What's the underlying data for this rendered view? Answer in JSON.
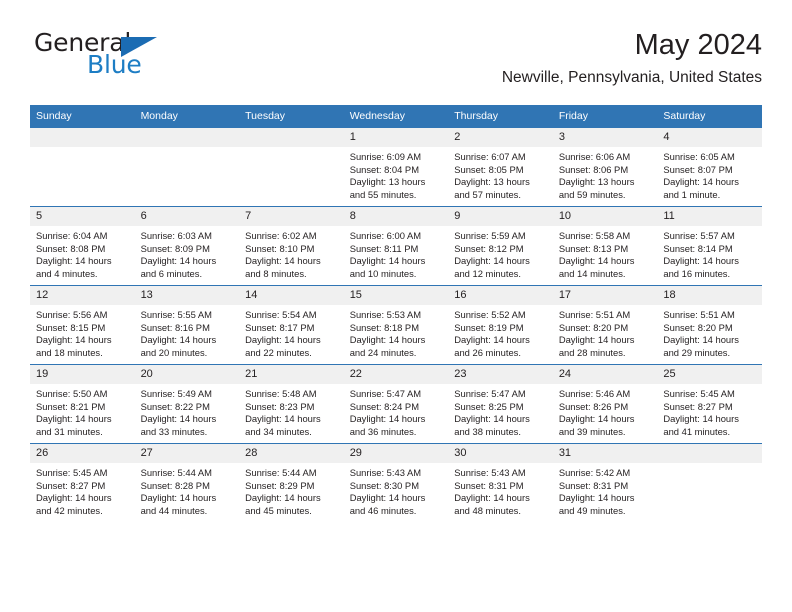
{
  "brand": {
    "name_part1": "General",
    "name_part2": "Blue",
    "triangle_color": "#1b6cb3",
    "blue_color": "#1d7dc4"
  },
  "header": {
    "title": "May 2024",
    "subtitle": "Newville, Pennsylvania, United States"
  },
  "colors": {
    "header_row_bg": "#3075b4",
    "daynum_bg": "#f0f0f0",
    "text": "#231f20"
  },
  "weekday_headers": [
    "Sunday",
    "Monday",
    "Tuesday",
    "Wednesday",
    "Thursday",
    "Friday",
    "Saturday"
  ],
  "weeks": [
    [
      {
        "day": "",
        "lines": []
      },
      {
        "day": "",
        "lines": []
      },
      {
        "day": "",
        "lines": []
      },
      {
        "day": "1",
        "lines": [
          "Sunrise: 6:09 AM",
          "Sunset: 8:04 PM",
          "Daylight: 13 hours",
          "and 55 minutes."
        ]
      },
      {
        "day": "2",
        "lines": [
          "Sunrise: 6:07 AM",
          "Sunset: 8:05 PM",
          "Daylight: 13 hours",
          "and 57 minutes."
        ]
      },
      {
        "day": "3",
        "lines": [
          "Sunrise: 6:06 AM",
          "Sunset: 8:06 PM",
          "Daylight: 13 hours",
          "and 59 minutes."
        ]
      },
      {
        "day": "4",
        "lines": [
          "Sunrise: 6:05 AM",
          "Sunset: 8:07 PM",
          "Daylight: 14 hours",
          "and 1 minute."
        ]
      }
    ],
    [
      {
        "day": "5",
        "lines": [
          "Sunrise: 6:04 AM",
          "Sunset: 8:08 PM",
          "Daylight: 14 hours",
          "and 4 minutes."
        ]
      },
      {
        "day": "6",
        "lines": [
          "Sunrise: 6:03 AM",
          "Sunset: 8:09 PM",
          "Daylight: 14 hours",
          "and 6 minutes."
        ]
      },
      {
        "day": "7",
        "lines": [
          "Sunrise: 6:02 AM",
          "Sunset: 8:10 PM",
          "Daylight: 14 hours",
          "and 8 minutes."
        ]
      },
      {
        "day": "8",
        "lines": [
          "Sunrise: 6:00 AM",
          "Sunset: 8:11 PM",
          "Daylight: 14 hours",
          "and 10 minutes."
        ]
      },
      {
        "day": "9",
        "lines": [
          "Sunrise: 5:59 AM",
          "Sunset: 8:12 PM",
          "Daylight: 14 hours",
          "and 12 minutes."
        ]
      },
      {
        "day": "10",
        "lines": [
          "Sunrise: 5:58 AM",
          "Sunset: 8:13 PM",
          "Daylight: 14 hours",
          "and 14 minutes."
        ]
      },
      {
        "day": "11",
        "lines": [
          "Sunrise: 5:57 AM",
          "Sunset: 8:14 PM",
          "Daylight: 14 hours",
          "and 16 minutes."
        ]
      }
    ],
    [
      {
        "day": "12",
        "lines": [
          "Sunrise: 5:56 AM",
          "Sunset: 8:15 PM",
          "Daylight: 14 hours",
          "and 18 minutes."
        ]
      },
      {
        "day": "13",
        "lines": [
          "Sunrise: 5:55 AM",
          "Sunset: 8:16 PM",
          "Daylight: 14 hours",
          "and 20 minutes."
        ]
      },
      {
        "day": "14",
        "lines": [
          "Sunrise: 5:54 AM",
          "Sunset: 8:17 PM",
          "Daylight: 14 hours",
          "and 22 minutes."
        ]
      },
      {
        "day": "15",
        "lines": [
          "Sunrise: 5:53 AM",
          "Sunset: 8:18 PM",
          "Daylight: 14 hours",
          "and 24 minutes."
        ]
      },
      {
        "day": "16",
        "lines": [
          "Sunrise: 5:52 AM",
          "Sunset: 8:19 PM",
          "Daylight: 14 hours",
          "and 26 minutes."
        ]
      },
      {
        "day": "17",
        "lines": [
          "Sunrise: 5:51 AM",
          "Sunset: 8:20 PM",
          "Daylight: 14 hours",
          "and 28 minutes."
        ]
      },
      {
        "day": "18",
        "lines": [
          "Sunrise: 5:51 AM",
          "Sunset: 8:20 PM",
          "Daylight: 14 hours",
          "and 29 minutes."
        ]
      }
    ],
    [
      {
        "day": "19",
        "lines": [
          "Sunrise: 5:50 AM",
          "Sunset: 8:21 PM",
          "Daylight: 14 hours",
          "and 31 minutes."
        ]
      },
      {
        "day": "20",
        "lines": [
          "Sunrise: 5:49 AM",
          "Sunset: 8:22 PM",
          "Daylight: 14 hours",
          "and 33 minutes."
        ]
      },
      {
        "day": "21",
        "lines": [
          "Sunrise: 5:48 AM",
          "Sunset: 8:23 PM",
          "Daylight: 14 hours",
          "and 34 minutes."
        ]
      },
      {
        "day": "22",
        "lines": [
          "Sunrise: 5:47 AM",
          "Sunset: 8:24 PM",
          "Daylight: 14 hours",
          "and 36 minutes."
        ]
      },
      {
        "day": "23",
        "lines": [
          "Sunrise: 5:47 AM",
          "Sunset: 8:25 PM",
          "Daylight: 14 hours",
          "and 38 minutes."
        ]
      },
      {
        "day": "24",
        "lines": [
          "Sunrise: 5:46 AM",
          "Sunset: 8:26 PM",
          "Daylight: 14 hours",
          "and 39 minutes."
        ]
      },
      {
        "day": "25",
        "lines": [
          "Sunrise: 5:45 AM",
          "Sunset: 8:27 PM",
          "Daylight: 14 hours",
          "and 41 minutes."
        ]
      }
    ],
    [
      {
        "day": "26",
        "lines": [
          "Sunrise: 5:45 AM",
          "Sunset: 8:27 PM",
          "Daylight: 14 hours",
          "and 42 minutes."
        ]
      },
      {
        "day": "27",
        "lines": [
          "Sunrise: 5:44 AM",
          "Sunset: 8:28 PM",
          "Daylight: 14 hours",
          "and 44 minutes."
        ]
      },
      {
        "day": "28",
        "lines": [
          "Sunrise: 5:44 AM",
          "Sunset: 8:29 PM",
          "Daylight: 14 hours",
          "and 45 minutes."
        ]
      },
      {
        "day": "29",
        "lines": [
          "Sunrise: 5:43 AM",
          "Sunset: 8:30 PM",
          "Daylight: 14 hours",
          "and 46 minutes."
        ]
      },
      {
        "day": "30",
        "lines": [
          "Sunrise: 5:43 AM",
          "Sunset: 8:31 PM",
          "Daylight: 14 hours",
          "and 48 minutes."
        ]
      },
      {
        "day": "31",
        "lines": [
          "Sunrise: 5:42 AM",
          "Sunset: 8:31 PM",
          "Daylight: 14 hours",
          "and 49 minutes."
        ]
      },
      {
        "day": "",
        "lines": []
      }
    ]
  ]
}
